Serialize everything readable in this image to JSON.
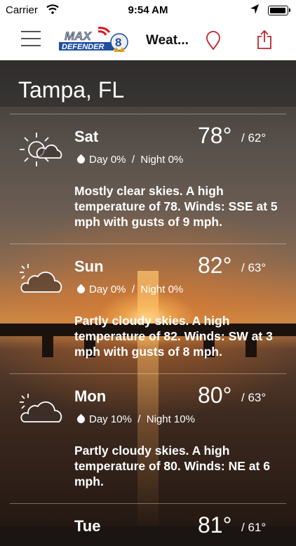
{
  "status_bar": {
    "carrier": "Carrier",
    "time": "9:54 AM"
  },
  "nav": {
    "title": "Weat...",
    "logo_top": "MAX",
    "logo_bottom": "DEFENDER",
    "logo_number": "8"
  },
  "city": "Tampa, FL",
  "forecast": [
    {
      "day": "Sat",
      "icon": "sun-cloud-icon",
      "high": "78°",
      "low": "/ 62°",
      "precip_day": "Day 0%",
      "precip_sep": "/",
      "precip_night": "Night 0%",
      "description": "Mostly clear skies.  A high temperature of 78.  Winds: SSE at 5 mph with gusts of 9 mph."
    },
    {
      "day": "Sun",
      "icon": "partly-cloudy-icon",
      "high": "82°",
      "low": "/ 63°",
      "precip_day": "Day 0%",
      "precip_sep": "/",
      "precip_night": "Night 0%",
      "description": "Partly cloudy skies.  A high temperature of 82.  Winds: SW at 3 mph with gusts of 8 mph."
    },
    {
      "day": "Mon",
      "icon": "partly-cloudy-icon",
      "high": "80°",
      "low": "/ 63°",
      "precip_day": "Day 10%",
      "precip_sep": "/",
      "precip_night": "Night 10%",
      "description": "Partly cloudy skies.  A high temperature of 80.  Winds: NE at 6 mph."
    },
    {
      "day": "Tue",
      "high": "81°",
      "low": "/ 61°"
    }
  ]
}
